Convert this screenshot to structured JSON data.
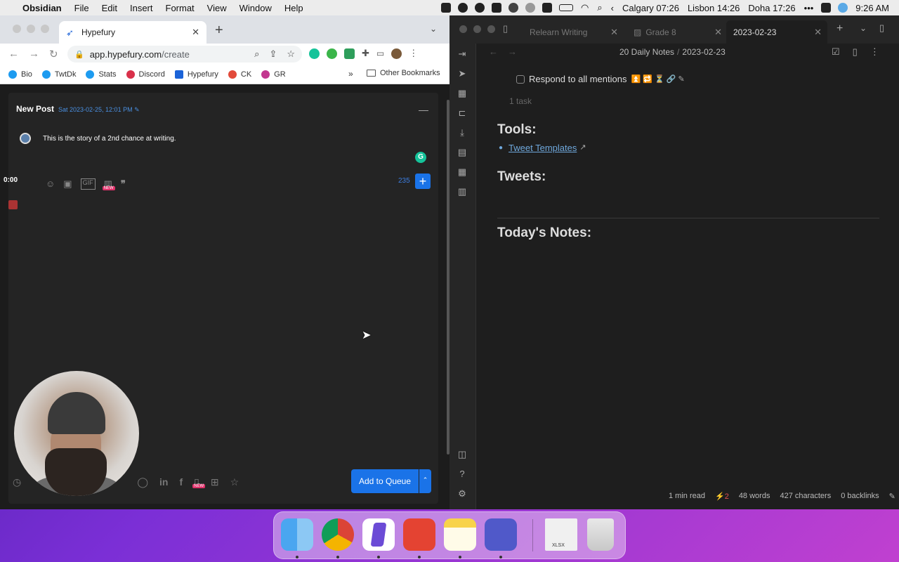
{
  "menubar": {
    "app": "Obsidian",
    "items": [
      "File",
      "Edit",
      "Insert",
      "Format",
      "View",
      "Window",
      "Help"
    ],
    "clocks": [
      "Calgary 07:26",
      "Lisbon 14:26",
      "Doha 17:26"
    ],
    "time": "9:26 AM"
  },
  "chrome": {
    "tab_title": "Hypefury",
    "url_host": "app.hypefury.com",
    "url_path": "/create",
    "bookmarks": [
      "Bio",
      "TwtDk",
      "Stats",
      "Discord",
      "Hypefury",
      "CK",
      "GR"
    ],
    "other_bookmarks": "Other Bookmarks",
    "more": "»"
  },
  "hypefury": {
    "title": "New Post",
    "date": "Sat 2023-02-25, 12:01 PM",
    "post_text": "This is the story of a 2nd chance at writing.",
    "char_count": "235",
    "add_to_queue": "Add to Queue",
    "recording_time": "0:00",
    "new_badge": "NEW"
  },
  "obsidian": {
    "tabs": [
      "Relearn Writing",
      "Grade 8",
      "2023-02-23"
    ],
    "breadcrumb_folder": "20 Daily Notes",
    "breadcrumb_file": "2023-02-23",
    "task_text": "Respond to all mentions",
    "task_count": "1 task",
    "tools_heading": "Tools:",
    "tweet_templates": "Tweet Templates",
    "tweets_heading": "Tweets:",
    "today_heading": "Today's Notes:",
    "status": {
      "read_time": "1 min read",
      "plugin_badge": "2",
      "words": "48 words",
      "chars": "427 characters",
      "backlinks": "0 backlinks"
    }
  },
  "dock": {
    "apps": [
      "finder",
      "chrome",
      "obsidian",
      "todoist",
      "notes",
      "teams",
      "xlsx-file",
      "trash"
    ],
    "xlsx_label": "XLSX"
  }
}
